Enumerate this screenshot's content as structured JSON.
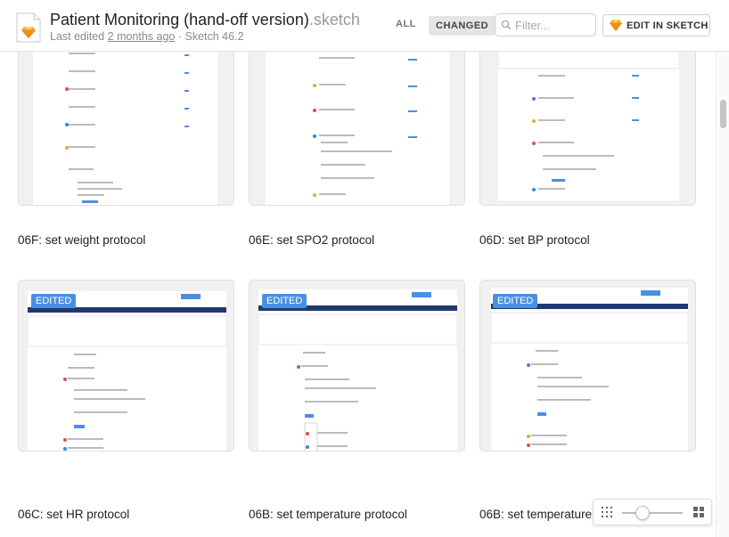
{
  "header": {
    "title": "Patient Monitoring (hand-off version)",
    "title_ext": ".sketch",
    "last_edited_prefix": "Last edited ",
    "last_edited_link": "2 months ago",
    "last_edited_suffix": " · Sketch 46.2",
    "filter_all": "ALL",
    "filter_changed": "CHANGED",
    "filter_placeholder": "Filter...",
    "edit_button": "EDIT IN SKETCH"
  },
  "artboards": [
    {
      "label": "06F: set weight protocol",
      "edited": false
    },
    {
      "label": "06E: set SPO2 protocol",
      "edited": false
    },
    {
      "label": "06D: set BP protocol",
      "edited": false
    },
    {
      "label": "06C: set HR protocol",
      "edited": true,
      "badge": "EDITED"
    },
    {
      "label": "06B: set temperature protocol",
      "edited": true,
      "badge": "EDITED"
    },
    {
      "label": "06B: set temperature",
      "edited": true,
      "badge": "EDITED"
    }
  ],
  "icons": {
    "file": "sketch-file-icon",
    "search": "search-icon",
    "sketch": "sketch-diamond-icon",
    "zoom_small": "small-grid-icon",
    "zoom_large": "large-grid-icon"
  },
  "colors": {
    "accent": "#4a90e2",
    "sketch_orange": "#f7a928",
    "thumb_header": "#1f3a6b"
  }
}
